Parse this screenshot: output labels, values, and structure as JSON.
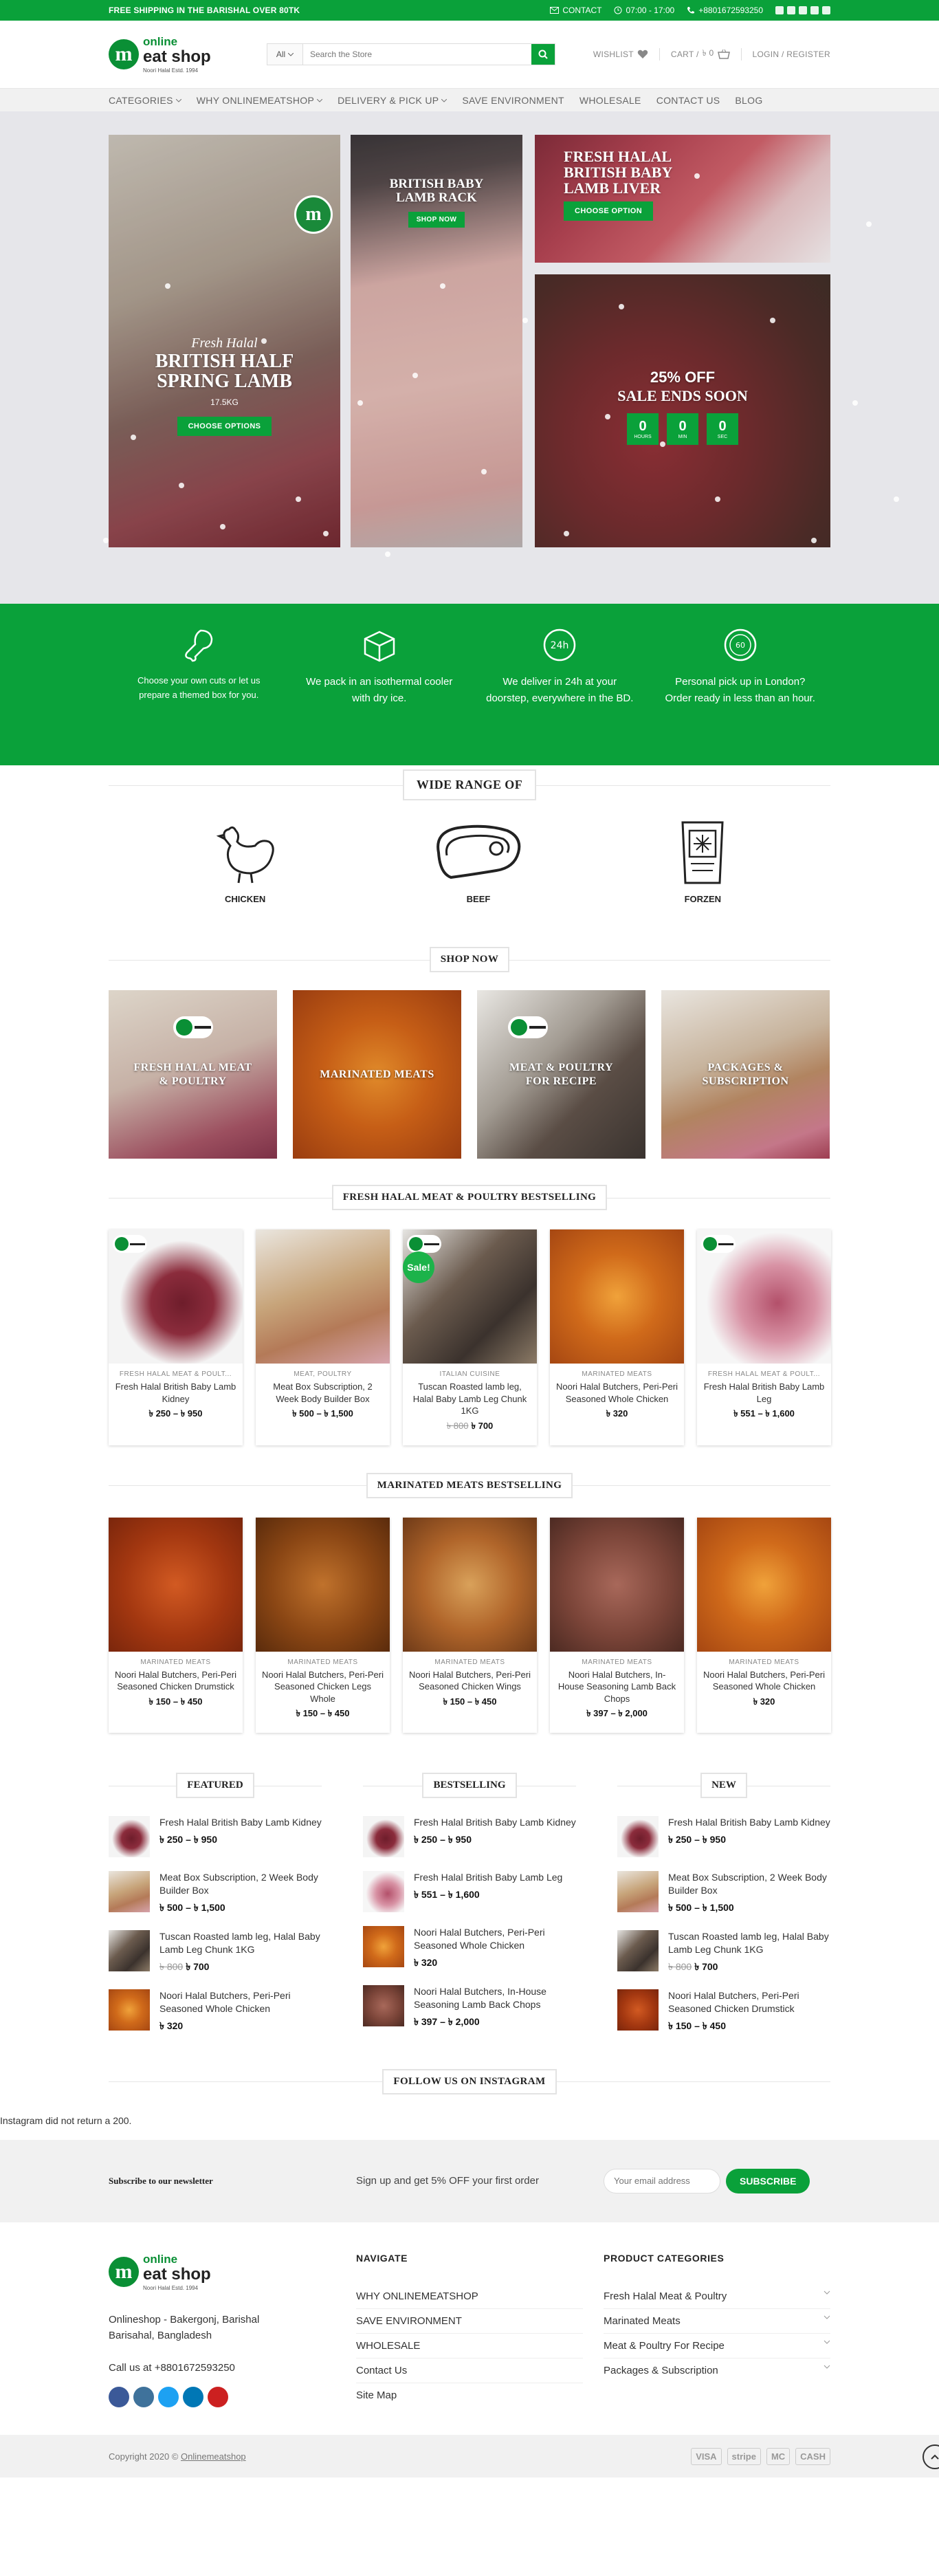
{
  "topbar": {
    "promo": "FREE SHIPPING IN THE BARISHAL OVER 80TK",
    "contact": "CONTACT",
    "hours": "07:00 - 17:00",
    "phone": "+8801672593250"
  },
  "header": {
    "logo_line1": "online",
    "logo_line2": "eat shop",
    "logo_m": "m",
    "logo_tag": "Noori Halal Estd. 1994",
    "search_category": "All",
    "search_placeholder": "Search the Store",
    "wishlist": "WISHLIST",
    "cart": "CART /",
    "cart_total": "৳ 0",
    "login": "LOGIN / REGISTER"
  },
  "nav": [
    "CATEGORIES",
    "WHY ONLINEMEATSHOP",
    "DELIVERY & PICK UP",
    "SAVE ENVIRONMENT",
    "WHOLESALE",
    "CONTACT US",
    "BLOG"
  ],
  "hero": {
    "t1_script": "Fresh Halal",
    "t1_title": "BRITISH HALF SPRING LAMB",
    "t1_weight": "17.5KG",
    "t1_btn": "CHOOSE OPTIONS",
    "t2_title": "BRITISH BABY LAMB RACK",
    "t2_btn": "SHOP NOW",
    "t3_title": "FRESH HALAL BRITISH BABY LAMB LIVER",
    "t3_btn": "CHOOSE OPTION",
    "t4_pct": "25% OFF",
    "t4_title": "SALE ENDS SOON",
    "countdown": [
      {
        "v": "0",
        "l": "HOURS"
      },
      {
        "v": "0",
        "l": "MIN"
      },
      {
        "v": "0",
        "l": "SEC"
      }
    ]
  },
  "features": [
    "Choose your own cuts or let us prepare a themed box for you.",
    "We pack in an isothermal cooler with dry ice.",
    "We deliver in 24h at your doorstep, everywhere in the BD.",
    "Personal pick up in London? Order ready in less than an hour."
  ],
  "range": {
    "title": "WIDE RANGE OF",
    "items": [
      "CHICKEN",
      "BEEF",
      "FORZEN"
    ]
  },
  "shop_now": {
    "title": "SHOP NOW",
    "cats": [
      "FRESH HALAL MEAT & POULTRY",
      "MARINATED MEATS",
      "MEAT & POULTRY FOR RECIPE",
      "PACKAGES & SUBSCRIPTION"
    ]
  },
  "best1": {
    "title": "FRESH HALAL MEAT & POULTRY BESTSELLING",
    "products": [
      {
        "cat": "FRESH HALAL MEAT & POULT...",
        "name": "Fresh Halal British Baby Lamb Kidney",
        "old": "",
        "price": "৳ 250 – ৳ 950"
      },
      {
        "cat": "MEAT, POULTRY",
        "name": "Meat Box Subscription, 2 Week Body Builder Box",
        "old": "",
        "price": "৳ 500 – ৳ 1,500"
      },
      {
        "cat": "ITALIAN CUISINE",
        "name": "Tuscan Roasted lamb leg, Halal Baby Lamb Leg Chunk 1KG",
        "old": "৳ 800",
        "price": "৳ 700",
        "sale": "Sale!"
      },
      {
        "cat": "MARINATED MEATS",
        "name": "Noori Halal Butchers, Peri-Peri Seasoned Whole Chicken",
        "old": "",
        "price": "৳ 320"
      },
      {
        "cat": "FRESH HALAL MEAT & POULT...",
        "name": "Fresh Halal British Baby Lamb Leg",
        "old": "",
        "price": "৳ 551 – ৳ 1,600"
      }
    ]
  },
  "best2": {
    "title": "MARINATED MEATS BESTSELLING",
    "products": [
      {
        "cat": "MARINATED MEATS",
        "name": "Noori Halal Butchers, Peri-Peri Seasoned Chicken Drumstick",
        "price": "৳ 150 – ৳ 450"
      },
      {
        "cat": "MARINATED MEATS",
        "name": "Noori Halal Butchers, Peri-Peri Seasoned Chicken Legs Whole",
        "price": "৳ 150 – ৳ 450"
      },
      {
        "cat": "MARINATED MEATS",
        "name": "Noori Halal Butchers, Peri-Peri Seasoned Chicken Wings",
        "price": "৳ 150 – ৳ 450"
      },
      {
        "cat": "MARINATED MEATS",
        "name": "Noori Halal Butchers, In-House Seasoning Lamb Back Chops",
        "price": "৳ 397 – ৳ 2,000"
      },
      {
        "cat": "MARINATED MEATS",
        "name": "Noori Halal Butchers, Peri-Peri Seasoned Whole Chicken",
        "price": "৳ 320"
      }
    ]
  },
  "lists": [
    {
      "title": "FEATURED",
      "items": [
        {
          "name": "Fresh Halal British Baby Lamb Kidney",
          "old": "",
          "price": "৳ 250 – ৳ 950"
        },
        {
          "name": "Meat Box Subscription, 2 Week Body Builder Box",
          "old": "",
          "price": "৳ 500 – ৳ 1,500"
        },
        {
          "name": "Tuscan Roasted lamb leg, Halal Baby Lamb Leg Chunk 1KG",
          "old": "৳ 800",
          "price": "৳ 700"
        },
        {
          "name": "Noori Halal Butchers, Peri-Peri Seasoned Whole Chicken",
          "old": "",
          "price": "৳ 320"
        }
      ]
    },
    {
      "title": "BESTSELLING",
      "items": [
        {
          "name": "Fresh Halal British Baby Lamb Kidney",
          "old": "",
          "price": "৳ 250 – ৳ 950"
        },
        {
          "name": "Fresh Halal British Baby Lamb Leg",
          "old": "",
          "price": "৳ 551 – ৳ 1,600"
        },
        {
          "name": "Noori Halal Butchers, Peri-Peri Seasoned Whole Chicken",
          "old": "",
          "price": "৳ 320"
        },
        {
          "name": "Noori Halal Butchers, In-House Seasoning Lamb Back Chops",
          "old": "",
          "price": "৳ 397 – ৳ 2,000"
        }
      ]
    },
    {
      "title": "NEW",
      "items": [
        {
          "name": "Fresh Halal British Baby Lamb Kidney",
          "old": "",
          "price": "৳ 250 – ৳ 950"
        },
        {
          "name": "Meat Box Subscription, 2 Week Body Builder Box",
          "old": "",
          "price": "৳ 500 – ৳ 1,500"
        },
        {
          "name": "Tuscan Roasted lamb leg, Halal Baby Lamb Leg Chunk 1KG",
          "old": "৳ 800",
          "price": "৳ 700"
        },
        {
          "name": "Noori Halal Butchers, Peri-Peri Seasoned Chicken Drumstick",
          "old": "",
          "price": "৳ 150 – ৳ 450"
        }
      ]
    }
  ],
  "instagram": {
    "title": "FOLLOW US ON INSTAGRAM",
    "error": "Instagram did not return a 200."
  },
  "newsletter": {
    "heading": "Subscribe to our newsletter",
    "sub": "Sign up and get 5% OFF your first order",
    "placeholder": "Your email address",
    "btn": "SUBSCRIBE"
  },
  "footer": {
    "address": "Onlineshop - Bakergonj, Barishal Barisahal, Bangladesh",
    "call": "Call us at +8801672593250",
    "nav_title": "NAVIGATE",
    "nav": [
      "WHY ONLINEMEATSHOP",
      "SAVE ENVIRONMENT",
      "WHOLESALE",
      "Contact Us",
      "Site Map"
    ],
    "cat_title": "PRODUCT CATEGORIES",
    "cats": [
      "Fresh Halal Meat & Poultry",
      "Marinated Meats",
      "Meat & Poultry For Recipe",
      "Packages & Subscription"
    ],
    "copyright": "Copyright 2020 ©",
    "copyright_link": "Onlinemeatshop",
    "pays": [
      "VISA",
      "stripe",
      "MC",
      "CASH"
    ]
  },
  "colors": {
    "accent": "#0aa13a"
  }
}
